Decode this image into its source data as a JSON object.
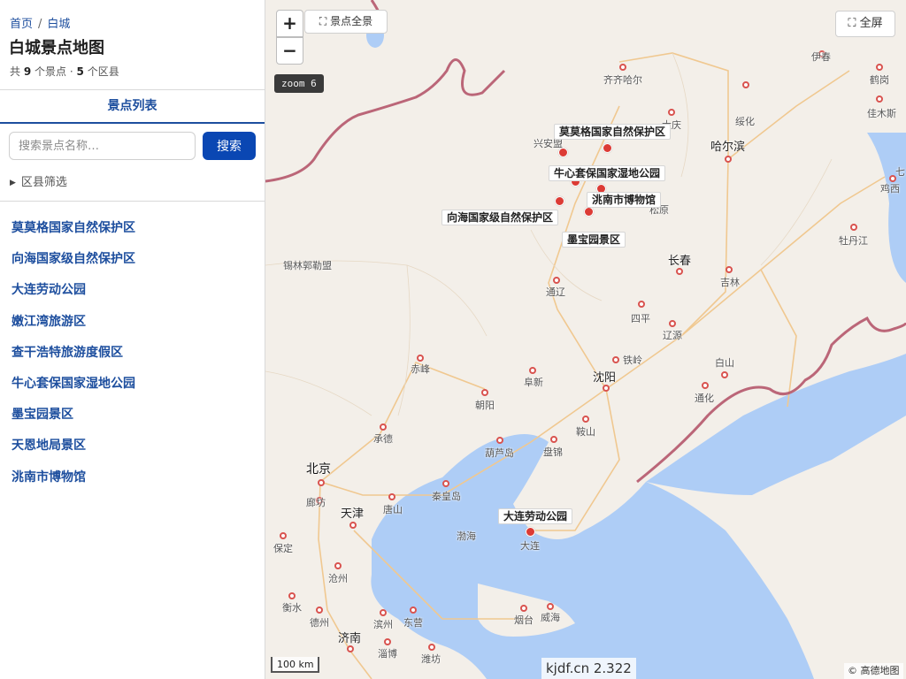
{
  "sidebar": {
    "breadcrumb": {
      "home": "首页",
      "sep": "/",
      "current": "白城"
    },
    "title": "白城景点地图",
    "summary": {
      "prefix": "共",
      "spot_count": "9",
      "mid": "个景点 ·",
      "district_count": "5",
      "suffix": "个区县"
    },
    "tab_label": "景点列表",
    "search": {
      "placeholder": "搜索景点名称…",
      "button": "搜索"
    },
    "filter_label": "区县筛选",
    "spots": [
      "莫莫格国家自然保护区",
      "向海国家级自然保护区",
      "大连劳动公园",
      "嫩江湾旅游区",
      "查干浩特旅游度假区",
      "牛心套保国家湿地公园",
      "墨宝园景区",
      "天恩地局景区",
      "洮南市博物馆"
    ]
  },
  "map": {
    "zoom_in": "+",
    "zoom_out": "−",
    "overview_button": "⛶ 景点全景",
    "fullscreen_button": "⛶ 全屏",
    "zoom_badge": "zoom 6",
    "scale": "100 km",
    "watermark": "kjdf.cn 2.322",
    "attribution": "© 高德地图",
    "colors": {
      "land": "#f3efe9",
      "sea": "#aecdf6",
      "border": "#b5566b",
      "road": "#f0c890",
      "poi": "#dc3b35",
      "accent": "#0a47b3"
    },
    "poi_labels": {
      "momoge": "莫莫格国家自然保护区",
      "niuxintao": "牛心套保国家湿地公园",
      "taonan": "洮南市博物馆",
      "xianghai": "向海国家级自然保护区",
      "mobaoyuan": "墨宝园景区",
      "dalian_park": "大连劳动公园"
    },
    "cities": {
      "yichun": "伊春",
      "hegang": "鹤岗",
      "jiamusi": "佳木斯",
      "qiqihar": "齐齐哈尔",
      "suihua": "绥化",
      "daqing": "大庆",
      "harbin": "哈尔滨",
      "xinganmeng": "兴安盟",
      "qi": "七",
      "jixi": "鸡西",
      "songyuan": "松原",
      "mudanjiang": "牡丹江",
      "xilingol": "锡林郭勒盟",
      "changchun": "长春",
      "jilin": "吉林",
      "tongliao": "通辽",
      "siping": "四平",
      "liaoyuan": "辽源",
      "chifeng": "赤峰",
      "fuxin": "阜新",
      "tieling": "铁岭",
      "baishan": "白山",
      "shenyang": "沈阳",
      "tonghua": "通化",
      "chaoyang": "朝阳",
      "anshan": "鞍山",
      "chengde": "承德",
      "huludao": "葫芦岛",
      "panjin": "盘锦",
      "beijing": "北京",
      "langfang": "廊坊",
      "qinhuangdao": "秦皇岛",
      "tianjin": "天津",
      "tangshan": "唐山",
      "bohai": "渤海",
      "dalian": "大连",
      "baoding": "保定",
      "cangzhou": "沧州",
      "hengshui": "衡水",
      "dezhou": "德州",
      "binzhou": "滨州",
      "dongying": "东营",
      "yantai": "烟台",
      "weihai": "威海",
      "jinan": "济南",
      "zibo": "淄博",
      "weifang": "潍坊"
    }
  }
}
